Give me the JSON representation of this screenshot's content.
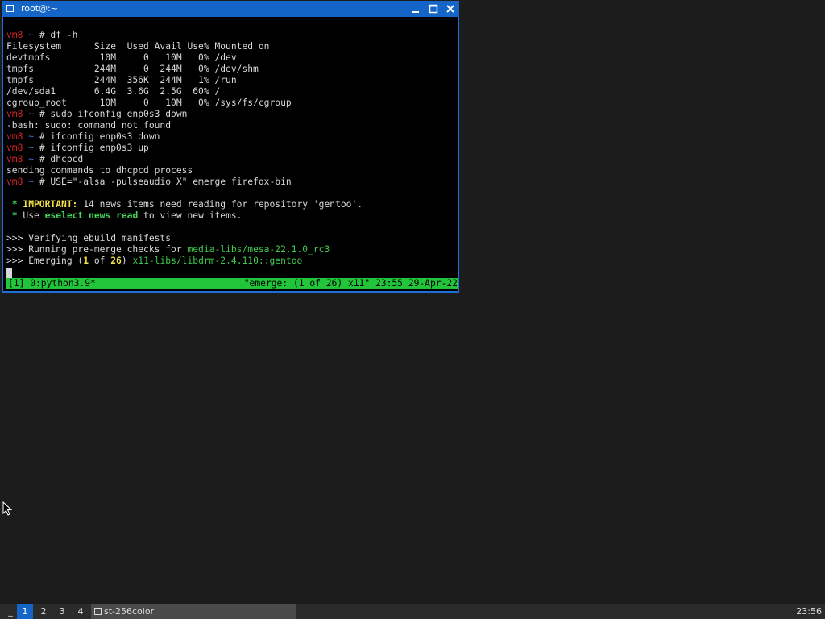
{
  "window": {
    "title": "root@:~"
  },
  "terminal": {
    "lines": [
      [
        {
          "t": "vm8",
          "c": "red"
        },
        {
          "t": " ~ ",
          "c": "blue"
        },
        {
          "t": "# df -h",
          "c": ""
        }
      ],
      [
        {
          "t": "Filesystem      Size  Used Avail Use% Mounted on",
          "c": ""
        }
      ],
      [
        {
          "t": "devtmpfs         10M     0   10M   0% /dev",
          "c": ""
        }
      ],
      [
        {
          "t": "tmpfs           244M     0  244M   0% /dev/shm",
          "c": ""
        }
      ],
      [
        {
          "t": "tmpfs           244M  356K  244M   1% /run",
          "c": ""
        }
      ],
      [
        {
          "t": "/dev/sda1       6.4G  3.6G  2.5G  60% /",
          "c": ""
        }
      ],
      [
        {
          "t": "cgroup_root      10M     0   10M   0% /sys/fs/cgroup",
          "c": ""
        }
      ],
      [
        {
          "t": "vm8",
          "c": "red"
        },
        {
          "t": " ~ ",
          "c": "blue"
        },
        {
          "t": "# sudo ifconfig enp0s3 down",
          "c": ""
        }
      ],
      [
        {
          "t": "-bash: sudo: command not found",
          "c": ""
        }
      ],
      [
        {
          "t": "vm8",
          "c": "red"
        },
        {
          "t": " ~ ",
          "c": "blue"
        },
        {
          "t": "# ifconfig enp0s3 down",
          "c": ""
        }
      ],
      [
        {
          "t": "vm8",
          "c": "red"
        },
        {
          "t": " ~ ",
          "c": "blue"
        },
        {
          "t": "# ifconfig enp0s3 up",
          "c": ""
        }
      ],
      [
        {
          "t": "vm8",
          "c": "red"
        },
        {
          "t": " ~ ",
          "c": "blue"
        },
        {
          "t": "# dhcpcd",
          "c": ""
        }
      ],
      [
        {
          "t": "sending commands to dhcpcd process",
          "c": ""
        }
      ],
      [
        {
          "t": "vm8",
          "c": "red"
        },
        {
          "t": " ~ ",
          "c": "blue"
        },
        {
          "t": "# USE=\"-alsa -pulseaudio X\" emerge firefox-bin",
          "c": ""
        }
      ],
      [
        {
          "t": "",
          "c": ""
        }
      ],
      [
        {
          "t": " * ",
          "c": "green-b"
        },
        {
          "t": "IMPORTANT:",
          "c": "yellow-b"
        },
        {
          "t": " 14 news items need reading for repository 'gentoo'.",
          "c": ""
        }
      ],
      [
        {
          "t": " * ",
          "c": "green-b"
        },
        {
          "t": "Use ",
          "c": ""
        },
        {
          "t": "eselect news read",
          "c": "green-b"
        },
        {
          "t": " to view new items.",
          "c": ""
        }
      ],
      [
        {
          "t": "",
          "c": ""
        }
      ],
      [
        {
          "t": ">>> Verifying ebuild manifests",
          "c": ""
        }
      ],
      [
        {
          "t": ">>> Running pre-merge checks for ",
          "c": ""
        },
        {
          "t": "media-libs/mesa-22.1.0_rc3",
          "c": "green"
        }
      ],
      [
        {
          "t": ">>> Emerging (",
          "c": ""
        },
        {
          "t": "1",
          "c": "yellow-b"
        },
        {
          "t": " of ",
          "c": ""
        },
        {
          "t": "26",
          "c": "yellow-b"
        },
        {
          "t": ") ",
          "c": ""
        },
        {
          "t": "x11-libs/libdrm-2.4.110::gentoo",
          "c": "green"
        }
      ]
    ]
  },
  "tmux": {
    "left": "[1] 0:python3.9*",
    "right": "\"emerge: (1 of 26) x11\" 23:55 29-Apr-22"
  },
  "taskbar": {
    "dash": "_",
    "workspaces": [
      "1",
      "2",
      "3",
      "4"
    ],
    "active_workspace": "1",
    "task_label": "st-256color",
    "clock": "23:56"
  },
  "colors": {
    "titlebar": "#1565c8",
    "tmux_bar": "#22c43a",
    "prompt_host": "#d6262a",
    "prompt_path": "#4a6fe3"
  }
}
